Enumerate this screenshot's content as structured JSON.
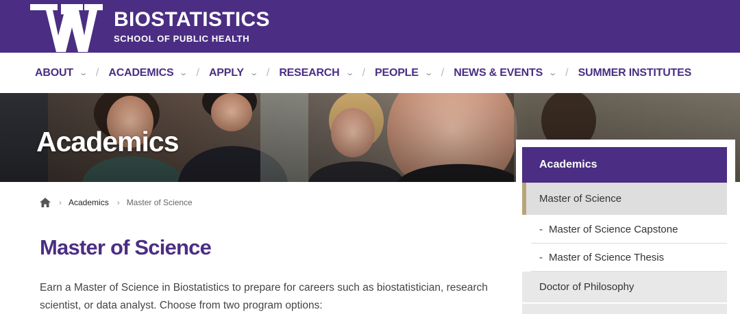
{
  "header": {
    "logo_letter": "W",
    "title": "BIOSTATISTICS",
    "subtitle": "SCHOOL OF PUBLIC HEALTH"
  },
  "nav": {
    "items": [
      {
        "label": "ABOUT",
        "has_caret": true
      },
      {
        "label": "ACADEMICS",
        "has_caret": true
      },
      {
        "label": "APPLY",
        "has_caret": true
      },
      {
        "label": "RESEARCH",
        "has_caret": true
      },
      {
        "label": "PEOPLE",
        "has_caret": true
      },
      {
        "label": "NEWS & EVENTS",
        "has_caret": true
      },
      {
        "label": "SUMMER INSTITUTES",
        "has_caret": false
      }
    ],
    "caret_glyph": "⌄",
    "separator": "/"
  },
  "hero": {
    "title": "Academics"
  },
  "breadcrumb": {
    "home_icon": "home-icon",
    "separator": "›",
    "link": "Academics",
    "current": "Master of Science"
  },
  "main": {
    "title": "Master of Science",
    "intro": "Earn a Master of Science in Biostatistics to prepare for careers such as biostatistician, research scientist, or data analyst. Choose from two program options:"
  },
  "sidebar": {
    "heading": "Academics",
    "active": "Master of Science",
    "subitems": [
      "Master of Science Capstone",
      "Master of Science Thesis"
    ],
    "dash": "-",
    "items": [
      "Doctor of Philosophy"
    ]
  },
  "colors": {
    "brand_purple": "#4b2e83",
    "gold_accent": "#b7a57a"
  }
}
